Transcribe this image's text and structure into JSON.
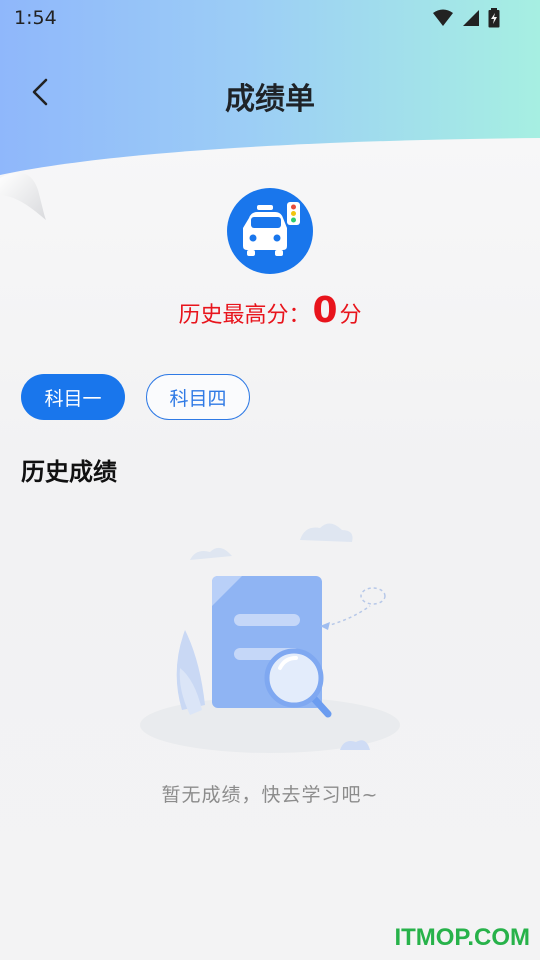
{
  "status_bar": {
    "time": "1:54"
  },
  "header": {
    "title": "成绩单"
  },
  "score": {
    "label": "历史最高分：",
    "value": "0",
    "unit": "分"
  },
  "tabs": [
    {
      "label": "科目一",
      "active": true
    },
    {
      "label": "科目四",
      "active": false
    }
  ],
  "section": {
    "title": "历史成绩"
  },
  "empty_state": {
    "message": "暂无成绩，快去学习吧~"
  },
  "watermark": {
    "text": "ITMOP.COM"
  },
  "colors": {
    "accent": "#1976ec",
    "score_red": "#e8141c",
    "watermark_green": "#27b24a"
  }
}
